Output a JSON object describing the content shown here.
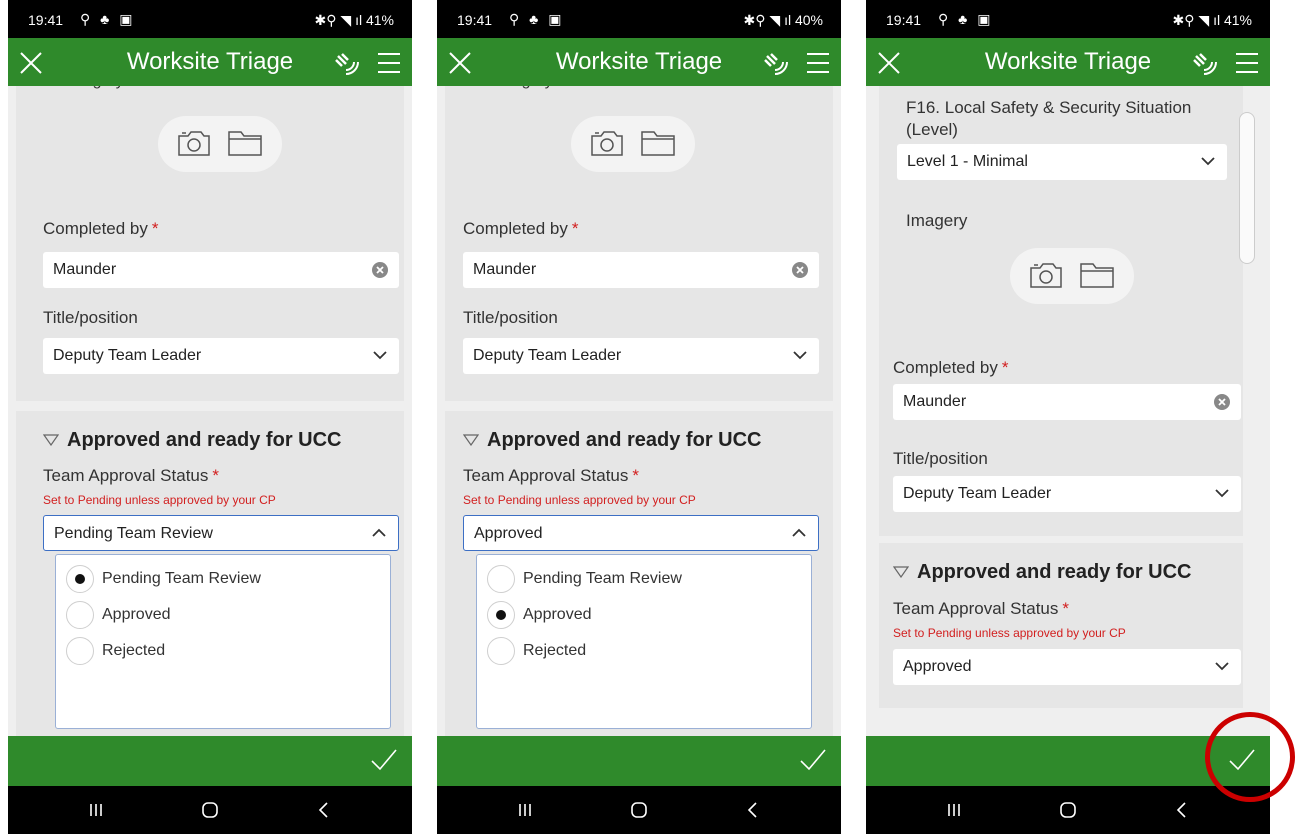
{
  "status_bars": [
    {
      "time": "19:41",
      "right": "✱⚲ ◥ ıl 41%"
    },
    {
      "time": "19:41",
      "right": "✱⚲ ◥ ıl 40%"
    },
    {
      "time": "19:41",
      "right": "✱⚲ ◥ ıl 41%"
    }
  ],
  "app": {
    "title": "Worksite Triage"
  },
  "form": {
    "imagery_label": "Imagery",
    "completed_by_label": "Completed by",
    "completed_by_value": "Maunder",
    "title_position_label": "Title/position",
    "title_position_value": "Deputy Team Leader",
    "section_title": "Approved and ready for UCC",
    "approval_label": "Team Approval Status",
    "approval_hint": "Set to Pending unless approved by your CP",
    "required_mark": "*",
    "f16_label": "F16. Local Safety & Security Situation (Level)",
    "f16_value": "Level 1 - Minimal"
  },
  "screens": [
    {
      "approval_value": "Pending Team Review",
      "selected_option": 0
    },
    {
      "approval_value": "Approved",
      "selected_option": 1
    },
    {
      "approval_value": "Approved"
    }
  ],
  "approval_options": [
    "Pending Team Review",
    "Approved",
    "Rejected"
  ],
  "colors": {
    "header": "#2f8a2b",
    "required": "#d21f1f",
    "highlight": "#cc0000"
  }
}
